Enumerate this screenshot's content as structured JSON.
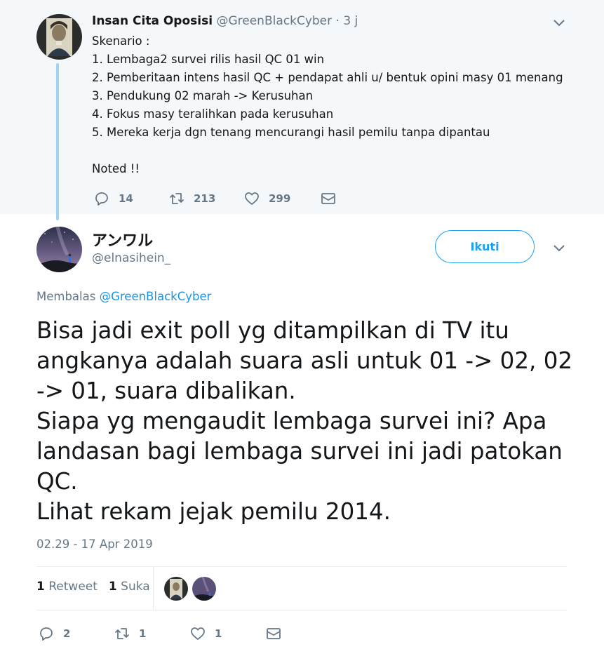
{
  "parent_tweet": {
    "name": "Insan Cita Oposisi",
    "handle_time": "@GreenBlackCyber · 3 j",
    "lines": [
      "Skenario :",
      "1. Lembaga2 survei rilis hasil QC 01 win",
      "2. Pemberitaan intens hasil QC + pendapat ahli u/ bentuk opini masy 01 menang",
      "3. Pendukung 02 marah -> Kerusuhan",
      "4. Fokus masy teralihkan pada kerusuhan",
      "5. Mereka kerja dgn tenang mencurangi hasil pemilu tanpa dipantau",
      "",
      "Noted !!"
    ],
    "reply_count": "14",
    "retweet_count": "213",
    "like_count": "299",
    "icons": [
      "reply-icon",
      "retweet-icon",
      "like-icon",
      "message-icon",
      "chevron-down-icon"
    ]
  },
  "reply_tweet": {
    "name": "アンワル",
    "handle": "@elnasihein_",
    "follow_label": "Ikuti",
    "replying_label": "Membalas",
    "replying_to": "@GreenBlackCyber",
    "lines": [
      "Bisa jadi exit poll yg ditampilkan di TV itu",
      "angkanya adalah suara asli untuk 01 -> 02, 02",
      "-> 01, suara dibalikan.",
      "Siapa yg mengaudit lembaga survei ini? Apa",
      "landasan bagi lembaga survei ini jadi patokan",
      "QC.",
      "Lihat rekam jejak pemilu 2014."
    ],
    "timestamp": "02.29 - 17 Apr 2019",
    "retweets_count": "1",
    "retweets_label": "Retweet",
    "likes_count": "1",
    "likes_label": "Suka",
    "reply_count": "2",
    "retweet_count": "1",
    "like_count": "1"
  },
  "colors": {
    "accent": "#1da1f2",
    "link": "#1b95e0",
    "secondary_text": "#657786",
    "thread_line": "#a3d2f2",
    "parent_bg": "#f5f8fa"
  }
}
